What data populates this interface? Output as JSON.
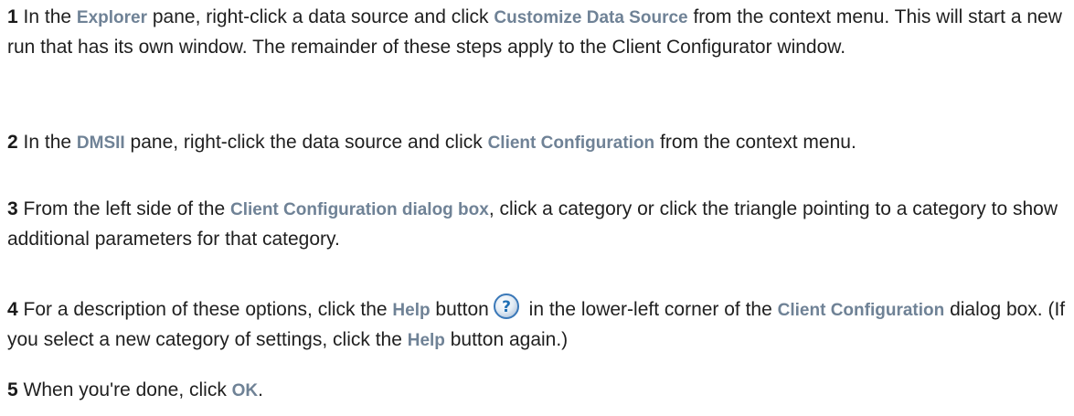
{
  "steps": [
    {
      "number": "1",
      "t1": "In the ",
      "b1": "Explorer",
      "t2": " pane, right-click a data source and click ",
      "b2": "Customize Data Source",
      "t3": " from the context menu. This will start a new run that has its own window. The remainder of these steps apply to the Client Configurator window."
    },
    {
      "number": "2",
      "t1": "In the ",
      "b1": "DMSII",
      "t2": " pane, right-click the data source and click ",
      "b2": "Client Configuration",
      "t3": " from the context menu."
    },
    {
      "number": "3",
      "t1": "From the left side of the ",
      "b1": "Client Configuration dialog box",
      "t2": ", click a category or click the triangle pointing to a category to show additional parameters for that category."
    },
    {
      "number": "4",
      "t1": "For a description of these options, click the ",
      "b1": "Help",
      "t2": " button",
      "icon": "help-question-icon",
      "t3": " in the lower-left corner of the ",
      "b2": "Client Configuration",
      "t4": " dialog box. (If you select a new category of settings, click the ",
      "b3": "Help",
      "t5": " button again.)"
    },
    {
      "number": "5",
      "t1": "When you're done, click ",
      "b1": "OK",
      "t2": "."
    }
  ],
  "colors": {
    "ui_term": "#6f8296",
    "body_text": "#1f1f1f",
    "help_icon": "#1f6fb5"
  }
}
